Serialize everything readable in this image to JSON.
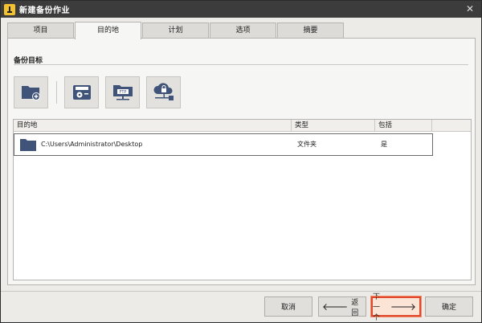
{
  "window": {
    "title": "新建备份作业"
  },
  "tabs": [
    {
      "label": "项目"
    },
    {
      "label": "目的地"
    },
    {
      "label": "计划"
    },
    {
      "label": "选项"
    },
    {
      "label": "摘要"
    }
  ],
  "active_tab": "目的地",
  "section": {
    "title": "备份目标"
  },
  "toolbar": {
    "buttons": [
      {
        "icon": "folder-add-icon"
      },
      {
        "icon": "disk-drive-icon"
      },
      {
        "icon": "ftp-folder-icon"
      },
      {
        "icon": "cloud-network-icon"
      }
    ]
  },
  "table": {
    "columns": [
      "目的地",
      "类型",
      "包括"
    ],
    "rows": [
      {
        "destination": "C:\\Users\\Administrator\\Desktop",
        "type": "文件夹",
        "include": "是"
      }
    ]
  },
  "buttons": {
    "cancel": "取消",
    "back": "返回",
    "next": "下一个",
    "ok": "确定"
  },
  "colors": {
    "titlebar": "#3c3c3c",
    "icon_blue": "#3f5478",
    "accent_red": "#e0492b"
  }
}
